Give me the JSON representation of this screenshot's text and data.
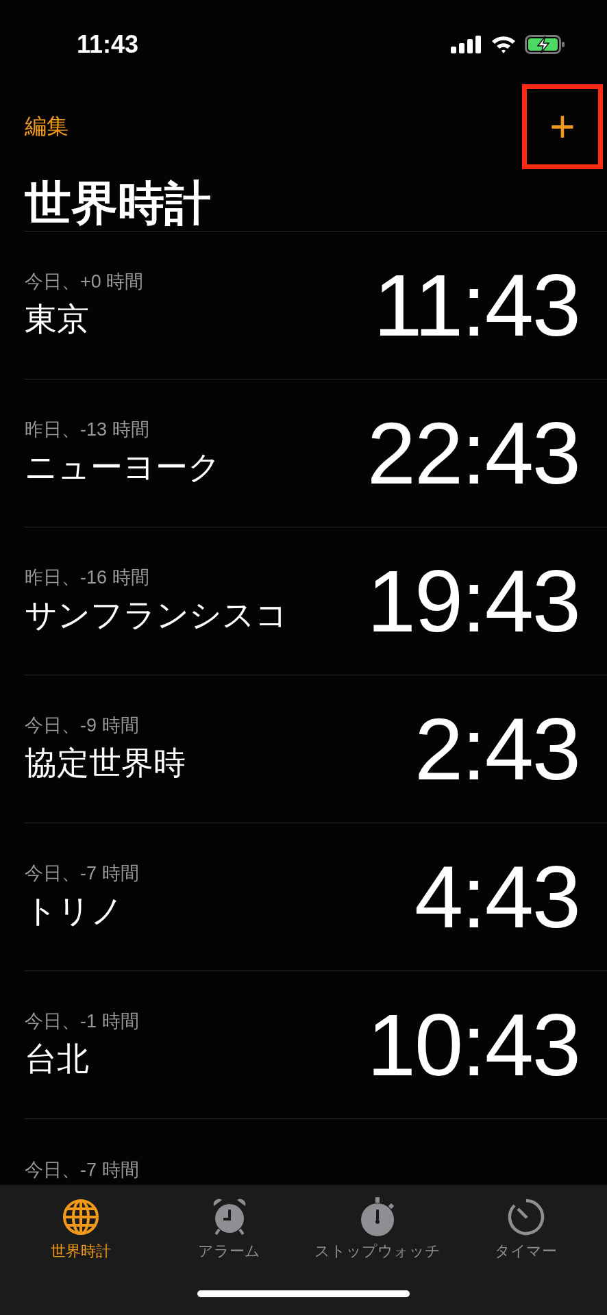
{
  "status_bar": {
    "time": "11:43",
    "battery_charging": true
  },
  "nav": {
    "edit": "編集",
    "add_button": {
      "label": "+",
      "highlighted": true
    },
    "title": "世界時計"
  },
  "clocks": [
    {
      "offset": "今日、+0 時間",
      "city": "東京",
      "time": "11:43"
    },
    {
      "offset": "昨日、-13 時間",
      "city": "ニューヨーク",
      "time": "22:43"
    },
    {
      "offset": "昨日、-16 時間",
      "city": "サンフランシスコ",
      "time": "19:43"
    },
    {
      "offset": "今日、-9 時間",
      "city": "協定世界時",
      "time": "2:43"
    },
    {
      "offset": "今日、-7 時間",
      "city": "トリノ",
      "time": "4:43"
    },
    {
      "offset": "今日、-1 時間",
      "city": "台北",
      "time": "10:43"
    },
    {
      "offset": "今日、-7 時間"
    }
  ],
  "tab_bar": [
    {
      "kind": "globe",
      "label": "世界時計",
      "selected": true
    },
    {
      "kind": "alarm",
      "label": "アラーム",
      "selected": false
    },
    {
      "kind": "stopwatch",
      "label": "ストップウォッチ",
      "selected": false
    },
    {
      "kind": "timer",
      "label": "タイマー",
      "selected": false
    }
  ]
}
